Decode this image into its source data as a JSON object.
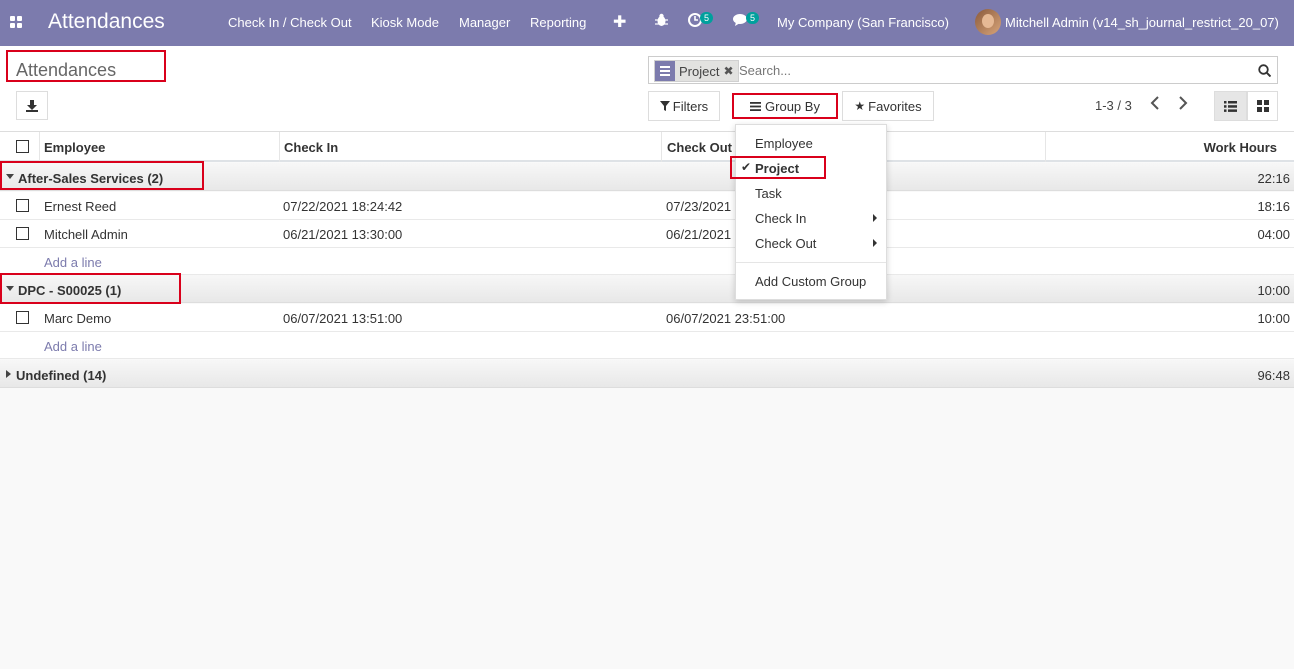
{
  "navbar": {
    "app_title": "Attendances",
    "menu": [
      "Check In / Check Out",
      "Kiosk Mode",
      "Manager",
      "Reporting"
    ],
    "activity_count": "5",
    "message_count": "5",
    "company": "My Company (San Francisco)",
    "user": "Mitchell Admin (v14_sh_journal_restrict_20_07)",
    "icons": [
      "apps-grid-icon",
      "plus-icon",
      "bug-icon",
      "clock-icon",
      "chat-icon"
    ]
  },
  "control_panel": {
    "breadcrumb_title": "Attendances",
    "search": {
      "facet_label": "Project",
      "placeholder": "Search..."
    },
    "filters_label": "Filters",
    "group_by_label": "Group By",
    "favorites_label": "Favorites",
    "pager": "1-3 / 3"
  },
  "table": {
    "columns": [
      "Employee",
      "Check In",
      "Check Out",
      "Work Hours"
    ],
    "groups": [
      {
        "label": "After-Sales Services (2)",
        "total": "22:16",
        "expanded": true,
        "rows": [
          {
            "employee": "Ernest Reed",
            "check_in": "07/22/2021 18:24:42",
            "check_out": "07/23/2021",
            "hours": "18:16"
          },
          {
            "employee": "Mitchell Admin",
            "check_in": "06/21/2021 13:30:00",
            "check_out": "06/21/2021",
            "hours": "04:00"
          }
        ],
        "add_line": "Add a line"
      },
      {
        "label": "DPC - S00025 (1)",
        "total": "10:00",
        "expanded": true,
        "rows": [
          {
            "employee": "Marc Demo",
            "check_in": "06/07/2021 13:51:00",
            "check_out": "06/07/2021 23:51:00",
            "hours": "10:00"
          }
        ],
        "add_line": "Add a line"
      },
      {
        "label": "Undefined (14)",
        "total": "96:48",
        "expanded": false,
        "rows": []
      }
    ]
  },
  "group_by_menu": {
    "items": [
      "Employee",
      "Project",
      "Task",
      "Check In",
      "Check Out"
    ],
    "selected": "Project",
    "custom_group": "Add Custom Group"
  },
  "colors": {
    "navbar": "#7c7bad",
    "highlight_box": "#d9001b",
    "link": "#7c7bad",
    "badge": "#00a09d"
  }
}
